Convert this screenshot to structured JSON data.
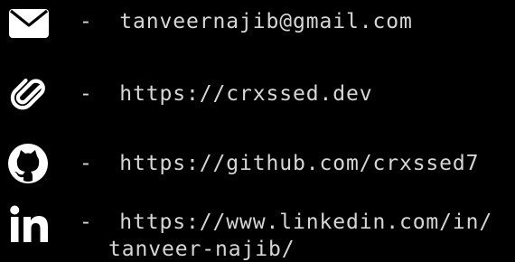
{
  "contacts": [
    {
      "icon": "mail-icon",
      "separator": "-",
      "text": "tanveernajib@gmail.com"
    },
    {
      "icon": "paperclip-icon",
      "separator": "-",
      "text": "https://crxssed.dev"
    },
    {
      "icon": "github-icon",
      "separator": "-",
      "text": "https://github.com/crxssed7"
    },
    {
      "icon": "linkedin-icon",
      "separator": "-",
      "text": "https://www.linkedin.com/in/",
      "text_continued": "tanveer-najib/"
    }
  ],
  "colors": {
    "background": "#000000",
    "text": "#d6d6d6",
    "icon": "#ffffff"
  }
}
